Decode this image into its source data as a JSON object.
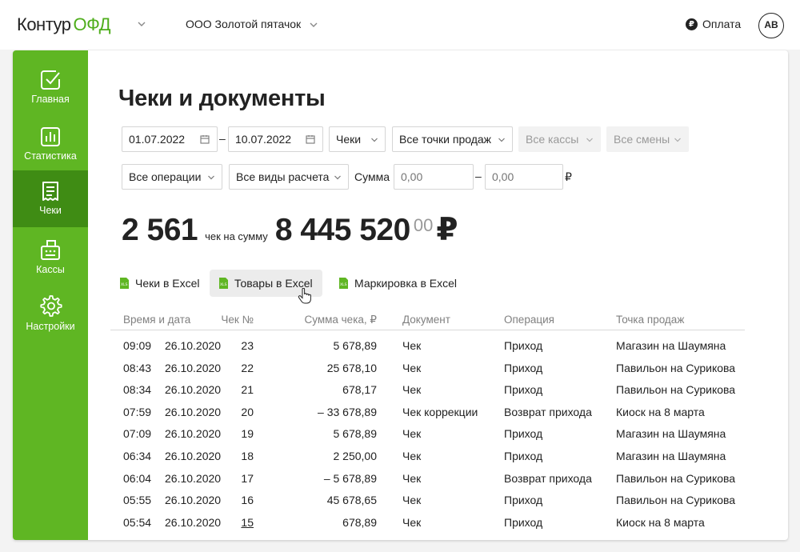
{
  "header": {
    "logo_part1": "Контур",
    "logo_part2": "ОФД",
    "org_name": "ООО Золотой пятачок",
    "pay_label": "Оплата",
    "pay_icon": "ruble-circle-icon",
    "avatar_initials": "АВ"
  },
  "sidebar": {
    "items": [
      {
        "label": "Главная",
        "icon": "check-square-icon"
      },
      {
        "label": "Статистика",
        "icon": "bar-chart-icon"
      },
      {
        "label": "Чеки",
        "icon": "receipt-icon"
      },
      {
        "label": "Кассы",
        "icon": "register-icon"
      },
      {
        "label": "Настройки",
        "icon": "gear-icon"
      }
    ],
    "active": "Чеки"
  },
  "page": {
    "title": "Чеки и документы"
  },
  "filters": {
    "date_from": "01.07.2022",
    "date_to": "10.07.2022",
    "dash": "–",
    "doc_type": "Чеки",
    "points": "Все точки продаж",
    "registers": "Все кассы",
    "shifts": "Все смены",
    "operations": "Все операции",
    "payment_types": "Все виды расчета",
    "sum_label": "Сумма",
    "sum_from_placeholder": "0,00",
    "sum_to_placeholder": "0,00",
    "currency": "₽"
  },
  "summary": {
    "count": "2 561",
    "count_label": "чек на сумму",
    "amount": "8 445 520",
    "kopecks": "00",
    "currency": "₽"
  },
  "exports": [
    {
      "label": "Чеки в Excel"
    },
    {
      "label": "Товары в Excel"
    },
    {
      "label": "Маркировка в Excel"
    }
  ],
  "table": {
    "headers": {
      "time_date": "Время и дата",
      "number": "Чек №",
      "sum": "Сумма чека, ₽",
      "document": "Документ",
      "operation": "Операция",
      "point": "Точка продаж"
    },
    "rows": [
      {
        "time": "09:09",
        "date": "26.10.2020",
        "number": "23",
        "sum": "5 678,89",
        "document": "Чек",
        "operation": "Приход",
        "point": "Магазин на Шаумяна"
      },
      {
        "time": "08:43",
        "date": "26.10.2020",
        "number": "22",
        "sum": "25 678,10",
        "document": "Чек",
        "operation": "Приход",
        "point": "Павильон на Сурикова"
      },
      {
        "time": "08:34",
        "date": "26.10.2020",
        "number": "21",
        "sum": "678,17",
        "document": "Чек",
        "operation": "Приход",
        "point": "Павильон на Сурикова"
      },
      {
        "time": "07:59",
        "date": "26.10.2020",
        "number": "20",
        "sum": "– 33 678,89",
        "document": "Чек коррекции",
        "operation": "Возврат прихода",
        "point": "Киоск на 8 марта"
      },
      {
        "time": "07:09",
        "date": "26.10.2020",
        "number": "19",
        "sum": "5 678,89",
        "document": "Чек",
        "operation": "Приход",
        "point": "Магазин на Шаумяна"
      },
      {
        "time": "06:34",
        "date": "26.10.2020",
        "number": "18",
        "sum": "2 250,00",
        "document": "Чек",
        "operation": "Приход",
        "point": "Магазин на Шаумяна"
      },
      {
        "time": "06:04",
        "date": "26.10.2020",
        "number": "17",
        "sum": "– 5 678,89",
        "document": "Чек",
        "operation": "Возврат прихода",
        "point": "Павильон на Сурикова"
      },
      {
        "time": "05:55",
        "date": "26.10.2020",
        "number": "16",
        "sum": "45 678,65",
        "document": "Чек",
        "operation": "Приход",
        "point": "Павильон на Сурикова"
      },
      {
        "time": "05:54",
        "date": "26.10.2020",
        "number": "15",
        "sum": "678,89",
        "document": "Чек",
        "operation": "Приход",
        "point": "Киоск на 8 марта"
      }
    ]
  },
  "colors": {
    "brand_green": "#5fb623",
    "active_green": "#3f8c14",
    "logo_green": "#4fae1c"
  }
}
